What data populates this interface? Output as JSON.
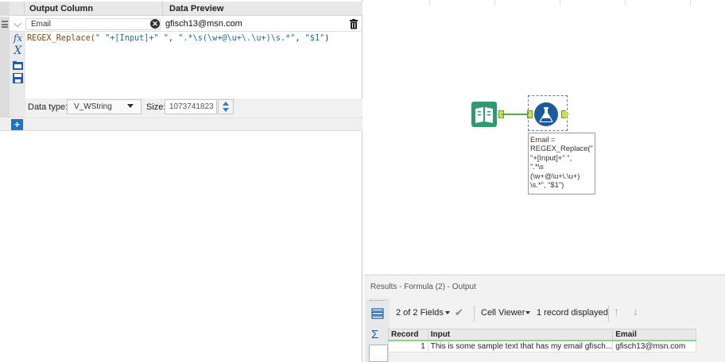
{
  "formula_panel": {
    "header": {
      "output_column": "Output Column",
      "data_preview": "Data Preview"
    },
    "row": {
      "output_column_value": "Email",
      "preview_value": "gfisch13@msn.com"
    },
    "expression": {
      "fn": "REGEX_Replace(",
      "arg1_open": "\" \"+",
      "field": "[Input]",
      "arg1_close": "+\" \"",
      "sep1": ", ",
      "pattern": "\".*\\s(\\w+@\\u+\\.\\u+)\\s.*\"",
      "sep2": ", ",
      "replacement": "\"$1\"",
      "close": ")"
    },
    "data_type_label": "Data type:",
    "data_type_value": "V_WString",
    "size_label": "Size:",
    "size_value": "1073741823",
    "icons": [
      "fx-icon",
      "variable-x-icon",
      "open-folder-icon",
      "save-icon",
      "trash-icon",
      "add-icon"
    ]
  },
  "canvas": {
    "tools": [
      "input-data-book-icon",
      "formula-flask-icon"
    ],
    "annotation": "Email =\nREGEX_Replace(\"\n\"+[Input]+\" \",\n\".*\\s\n(\\w+@\\u+\\.\\u+)\n\\s.*\", \"$1\")"
  },
  "results": {
    "title": "Results - Formula (2) - Output",
    "fields_dropdown": "2 of 2 Fields",
    "viewer_dropdown": "Cell Viewer",
    "record_count": "1 record displayed",
    "columns": [
      "Record",
      "Input",
      "Email"
    ],
    "rows": [
      {
        "record": "1",
        "input": "This is some sample text that has my email gfisch...",
        "email": "gfisch13@msn.com"
      }
    ]
  },
  "colors": {
    "accent": "#1d73c7",
    "connection": "#5aa55a",
    "anchor": "#c9e34a",
    "input_tool": "#2e9b6e",
    "formula_tool": "#1c5a9e"
  }
}
